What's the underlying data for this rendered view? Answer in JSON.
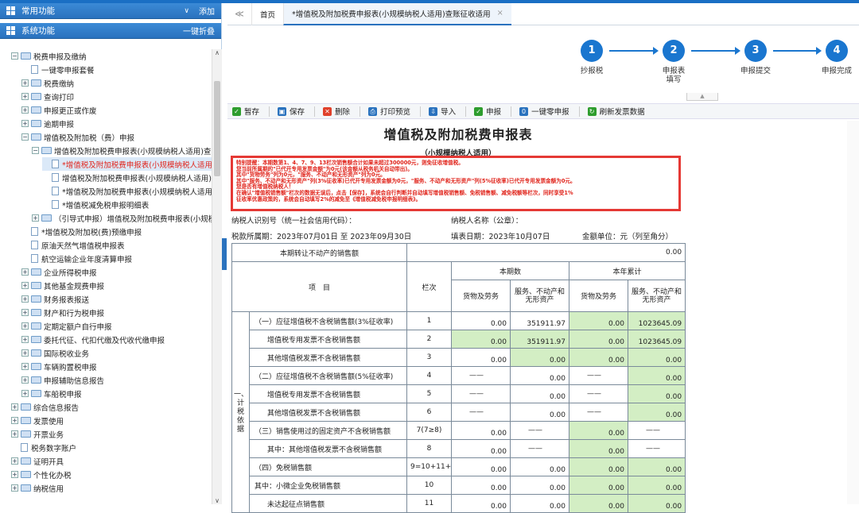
{
  "sidebar": {
    "common_label": "常用功能",
    "common_action": "添加",
    "system_label": "系统功能",
    "system_action": "一键折叠",
    "tree": [
      {
        "label": "税费申报及缴纳"
      },
      {
        "label": "一键零申报套餐"
      },
      {
        "label": "税费缴纳"
      },
      {
        "label": "查询打印"
      },
      {
        "label": "申报更正或作废"
      },
      {
        "label": "逾期申报"
      },
      {
        "label": "增值税及附加税（费）申报"
      },
      {
        "label": "增值税及附加税费申报表(小规模纳税人适用)查"
      },
      {
        "label": "*增值税及附加税费申报表(小规模纳税人适用)"
      },
      {
        "label": "增值税及附加税费申报表(小规模纳税人适用)附"
      },
      {
        "label": "*增值税及附加税费申报表(小规模纳税人适用)附"
      },
      {
        "label": "*增值税减免税申报明细表"
      },
      {
        "label": "（引导式申报）增值税及附加税费申报表(小规模"
      },
      {
        "label": "*增值税及附加税(费)预缴申报"
      },
      {
        "label": "原油天然气增值税申报表"
      },
      {
        "label": "航空运输企业年度清算申报"
      },
      {
        "label": "企业所得税申报"
      },
      {
        "label": "其他基金规费申报"
      },
      {
        "label": "财务报表报送"
      },
      {
        "label": "财产和行为税申报"
      },
      {
        "label": "定期定额户自行申报"
      },
      {
        "label": "委托代征、代扣代缴及代收代缴申报"
      },
      {
        "label": "国际税收业务"
      },
      {
        "label": "车辆购置税申报"
      },
      {
        "label": "申报辅助信息报告"
      },
      {
        "label": "车船税申报"
      },
      {
        "label": "综合信息报告"
      },
      {
        "label": "发票使用"
      },
      {
        "label": "开票业务"
      },
      {
        "label": "税务数字账户"
      },
      {
        "label": "证明开具"
      },
      {
        "label": "个性化办税"
      },
      {
        "label": "纳税信用"
      }
    ]
  },
  "tabs": {
    "collapse": "≪",
    "home": "首页",
    "active": "*增值税及附加税费申报表(小规模纳税人适用)查账征收适用",
    "close": "×"
  },
  "steps": [
    {
      "num": "1",
      "label": "抄报税"
    },
    {
      "num": "2",
      "label": "申报表\n填写"
    },
    {
      "num": "3",
      "label": "申报提交"
    },
    {
      "num": "4",
      "label": "申报完成"
    }
  ],
  "toolbar": [
    {
      "label": "暂存",
      "icon": "check-icon",
      "color": "#2e9d2e"
    },
    {
      "label": "保存",
      "icon": "save-icon",
      "color": "#2a72be"
    },
    {
      "label": "删除",
      "icon": "delete-icon",
      "color": "#e0402b"
    },
    {
      "label": "打印预览",
      "icon": "print-icon",
      "color": "#2a72be"
    },
    {
      "label": "导入",
      "icon": "import-icon",
      "color": "#2a72be"
    },
    {
      "label": "申报",
      "icon": "declare-icon",
      "color": "#2e9d2e"
    },
    {
      "label": "一键零申报",
      "icon": "zero-declare-icon",
      "color": "#2a72be"
    },
    {
      "label": "刷新发票数据",
      "icon": "refresh-icon",
      "color": "#2e9d2e"
    }
  ],
  "form": {
    "title": "增值税及附加税费申报表",
    "subtitle": "（小规模纳税人适用）",
    "warning_lines": [
      "特别提醒：本期数第1、4、7、9、13栏次销售额合计如果未超过300000元，则免征收增值税。",
      "您当前所属期的\"已代开专用发票金额\"为0元(该金额从税务机关自动带出)。",
      "其中\"货物劳务\"列为0元，\"服务、不动产和无形资产\"列为0元。",
      "其中\"服务、不动产和无形资产\"列(3%征收率)已代开专用发票金额为0元，\"服务、不动产和无形资产\"列(5%征收率)已代开专用发票金额为0元。",
      "您是否有增值税纳税人！",
      "在确认\"增值税销售额\"栏次的数据无误后，点击【保存】，系统会自行判断并自动填写增值税销售额、免税销售额、减免税额等栏次，同时享受1%",
      "征收率优惠政策的，系统会自动填写2%的减免至《增值税减免税申报明细表》。"
    ],
    "taxpayer_id_label": "纳税人识别号（统一社会信用代码）：",
    "taxpayer_name_label": "纳税人名称（公章）：",
    "period": "税款所属期：2023年07月01日 至 2023年09月30日",
    "fill_date": "填表日期：2023年10月07日",
    "unit": "金额单位：元（列至角分）",
    "transfer_label": "本期转让不动产的销售额",
    "transfer_value": "0.00",
    "hdr": {
      "item": "项　目",
      "col": "栏次",
      "current": "本期数",
      "ytd": "本年累计",
      "goods": "货物及劳务",
      "services": "服务、不动产和无形资产"
    },
    "section_label": "一、计税依据",
    "rows": [
      {
        "item": "（一）应征增值税不含税销售额(3%征收率)",
        "col": "1",
        "c1": "0.00",
        "c2": "351911.97",
        "c3": "0.00",
        "c4": "1023645.09"
      },
      {
        "item": "增值税专用发票不含税销售额",
        "col": "2",
        "c1": "0.00",
        "c2": "351911.97",
        "c3": "0.00",
        "c4": "1023645.09"
      },
      {
        "item": "其他增值税发票不含税销售额",
        "col": "3",
        "c1": "0.00",
        "c2": "0.00",
        "c3": "0.00",
        "c4": "0.00"
      },
      {
        "item": "（二）应征增值税不含税销售额(5%征收率)",
        "col": "4",
        "c1": "——",
        "c2": "0.00",
        "c3": "——",
        "c4": "0.00"
      },
      {
        "item": "增值税专用发票不含税销售额",
        "col": "5",
        "c1": "——",
        "c2": "0.00",
        "c3": "——",
        "c4": "0.00"
      },
      {
        "item": "其他增值税发票不含税销售额",
        "col": "6",
        "c1": "——",
        "c2": "0.00",
        "c3": "——",
        "c4": "0.00"
      },
      {
        "item": "（三）销售使用过的固定资产不含税销售额",
        "col": "7(7≥8)",
        "c1": "0.00",
        "c2": "——",
        "c3": "0.00",
        "c4": "——"
      },
      {
        "item": "其中：其他增值税发票不含税销售额",
        "col": "8",
        "c1": "0.00",
        "c2": "——",
        "c3": "0.00",
        "c4": "——"
      },
      {
        "item": "（四）免税销售额",
        "col": "9=10+11+12",
        "c1": "0.00",
        "c2": "0.00",
        "c3": "0.00",
        "c4": "0.00"
      },
      {
        "item": "其中：小微企业免税销售额",
        "col": "10",
        "c1": "0.00",
        "c2": "0.00",
        "c3": "0.00",
        "c4": "0.00"
      },
      {
        "item": "未达起征点销售额",
        "col": "11",
        "c1": "0.00",
        "c2": "0.00",
        "c3": "0.00",
        "c4": "0.00"
      }
    ]
  }
}
